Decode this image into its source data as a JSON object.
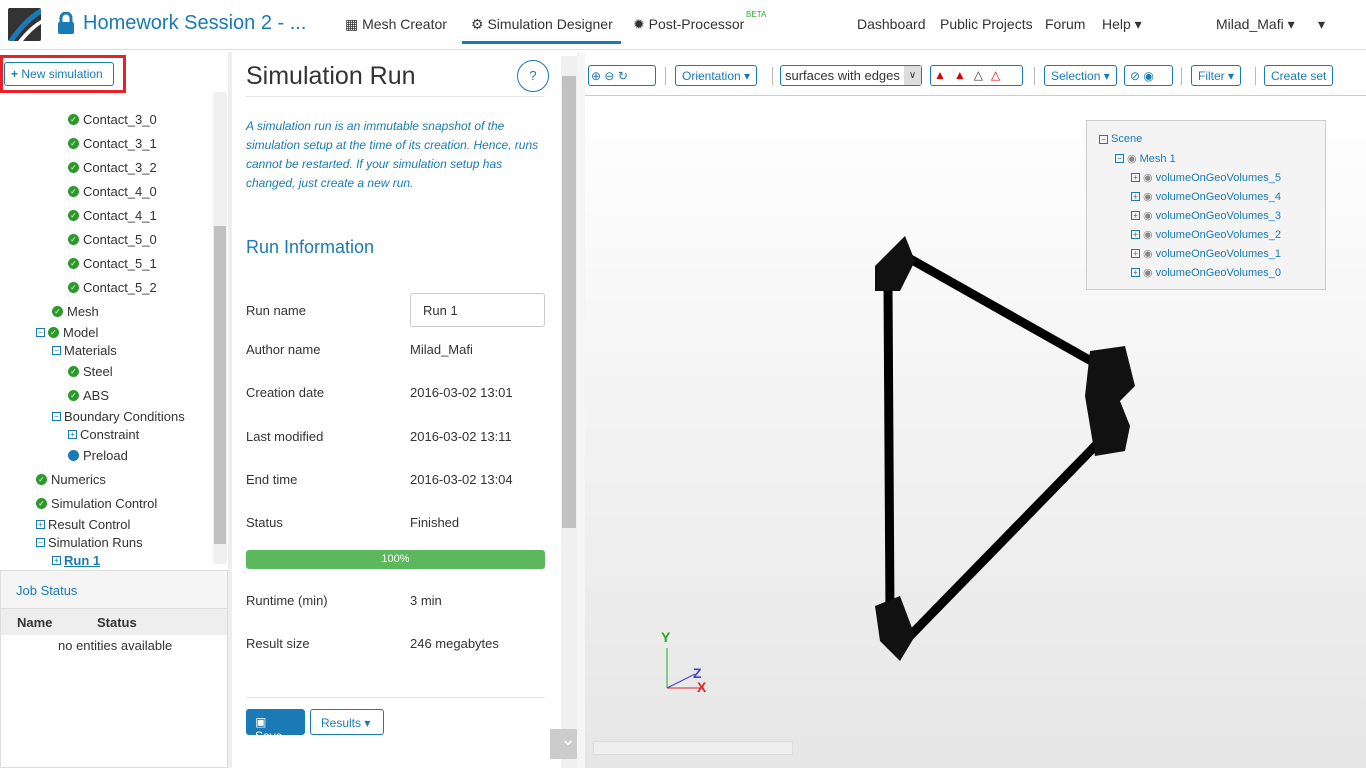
{
  "header": {
    "title": "Homework Session 2 - ...",
    "nav": [
      {
        "label": "Mesh Creator",
        "icon": "grid-icon"
      },
      {
        "label": "Simulation Designer",
        "icon": "gears-icon",
        "active": true
      },
      {
        "label": "Post-Processor",
        "icon": "gear-icon",
        "badge": "BETA"
      }
    ],
    "right": [
      "Dashboard",
      "Public Projects",
      "Forum",
      "Help"
    ],
    "user": "Milad_Mafi"
  },
  "sidebar": {
    "new_simulation": "New simulation",
    "tree": [
      {
        "label": "Contact_3_0",
        "level": 3,
        "icon": "check"
      },
      {
        "label": "Contact_3_1",
        "level": 3,
        "icon": "check"
      },
      {
        "label": "Contact_3_2",
        "level": 3,
        "icon": "check"
      },
      {
        "label": "Contact_4_0",
        "level": 3,
        "icon": "check"
      },
      {
        "label": "Contact_4_1",
        "level": 3,
        "icon": "check"
      },
      {
        "label": "Contact_5_0",
        "level": 3,
        "icon": "check"
      },
      {
        "label": "Contact_5_1",
        "level": 3,
        "icon": "check"
      },
      {
        "label": "Contact_5_2",
        "level": 3,
        "icon": "check"
      },
      {
        "label": "Mesh",
        "level": 1,
        "icon": "check"
      },
      {
        "label": "Model",
        "level": 0,
        "icon": "minus-check"
      },
      {
        "label": "Materials",
        "level": 1,
        "icon": "minus"
      },
      {
        "label": "Steel",
        "level": 2,
        "icon": "check"
      },
      {
        "label": "ABS",
        "level": 2,
        "icon": "check"
      },
      {
        "label": "Boundary Conditions",
        "level": 1,
        "icon": "minus"
      },
      {
        "label": "Constraint",
        "level": 2,
        "icon": "plus"
      },
      {
        "label": "Preload",
        "level": 2,
        "icon": "dot"
      },
      {
        "label": "Numerics",
        "level": 0,
        "icon": "check"
      },
      {
        "label": "Simulation Control",
        "level": 0,
        "icon": "check"
      },
      {
        "label": "Result Control",
        "level": 0,
        "icon": "plus"
      },
      {
        "label": "Simulation Runs",
        "level": 0,
        "icon": "minus"
      },
      {
        "label": "Run 1",
        "level": 1,
        "icon": "plus",
        "selected": true
      }
    ]
  },
  "job_status": {
    "title": "Job Status",
    "columns": [
      "Name",
      "Status"
    ],
    "empty": "no entities available"
  },
  "run": {
    "title": "Simulation Run",
    "help": "?",
    "description": "A simulation run is an immutable snapshot of the simulation setup at the time of its creation. Hence, runs cannot be restarted. If your simulation setup has changed, just create a new run.",
    "section": "Run Information",
    "fields": [
      {
        "label": "Run name",
        "value": "Run 1",
        "input": true
      },
      {
        "label": "Author name",
        "value": "Milad_Mafi"
      },
      {
        "label": "Creation date",
        "value": "2016-03-02 13:01"
      },
      {
        "label": "Last modified",
        "value": "2016-03-02 13:11"
      },
      {
        "label": "End time",
        "value": "2016-03-02 13:04"
      },
      {
        "label": "Status",
        "value": "Finished"
      }
    ],
    "progress": 100,
    "progress_label": "100%",
    "runtime_label": "Runtime (min)",
    "runtime": "3 min",
    "size_label": "Result size",
    "size": "246 megabytes",
    "save": "Save",
    "results": "Results"
  },
  "viewer": {
    "orientation": "Orientation",
    "render_mode": "surfaces with edges",
    "selection": "Selection",
    "filter": "Filter",
    "create_set": "Create set",
    "scene": {
      "root": "Scene",
      "mesh": "Mesh 1",
      "volumes": [
        "volumeOnGeoVolumes_5",
        "volumeOnGeoVolumes_4",
        "volumeOnGeoVolumes_3",
        "volumeOnGeoVolumes_2",
        "volumeOnGeoVolumes_1",
        "volumeOnGeoVolumes_0"
      ]
    },
    "axes": {
      "x": "X",
      "y": "Y",
      "z": "Z"
    }
  },
  "colors": {
    "accent": "#1a7ab5",
    "success": "#5cb85c",
    "highlight": "#e8202a"
  }
}
